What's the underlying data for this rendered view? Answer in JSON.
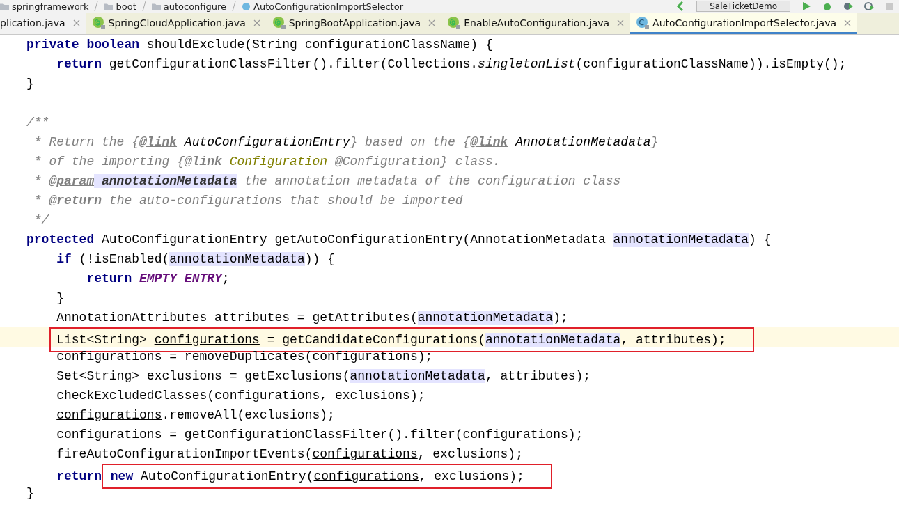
{
  "breadcrumb": [
    {
      "label": "springframework",
      "kind": "folder"
    },
    {
      "label": "boot",
      "kind": "folder"
    },
    {
      "label": "autoconfigure",
      "kind": "folder"
    },
    {
      "label": "AutoConfigurationImportSelector",
      "kind": "class"
    }
  ],
  "run_config": "SaleTicketDemo",
  "tabs": [
    {
      "label": "plication.java",
      "kind": "none",
      "selected": false
    },
    {
      "label": "SpringCloudApplication.java",
      "kind": "annotation",
      "selected": false
    },
    {
      "label": "SpringBootApplication.java",
      "kind": "annotation",
      "selected": false
    },
    {
      "label": "EnableAutoConfiguration.java",
      "kind": "annotation",
      "selected": false
    },
    {
      "label": "AutoConfigurationImportSelector.java",
      "kind": "class",
      "selected": true
    }
  ],
  "lines": [
    {
      "kind": "code",
      "tokens": [
        {
          "text": "private boolean",
          "kind": "kw"
        },
        {
          "text": " shouldExclude(String configurationClassName) {",
          "kind": "plain"
        }
      ],
      "children": [
        {
          "kind": "code",
          "tokens": [
            {
              "text": "return",
              "kind": "kw"
            },
            {
              "text": " getConfigurationClassFilter().filter(Collections.",
              "kind": "plain"
            },
            {
              "text": "singletonList",
              "kind": "static"
            },
            {
              "text": "(configurationClassName)).isEmpty();",
              "kind": "plain"
            }
          ]
        }
      ]
    },
    {
      "kind": "code",
      "tokens": [
        {
          "text": "}",
          "kind": "plain"
        }
      ]
    },
    {
      "kind": "blank"
    },
    {
      "kind": "code",
      "tokens": [
        {
          "text": "/**",
          "kind": "doc"
        }
      ]
    },
    {
      "kind": "code",
      "tokens": [
        {
          "text": " * Return the {",
          "kind": "doc"
        },
        {
          "text": "@link",
          "kind": "doctag"
        },
        {
          "text": " AutoConfigurationEntry",
          "kind": "docref"
        },
        {
          "text": "} based on the {",
          "kind": "doc"
        },
        {
          "text": "@link",
          "kind": "doctag"
        },
        {
          "text": " AnnotationMetadata",
          "kind": "docref"
        },
        {
          "text": "}",
          "kind": "doc"
        }
      ]
    },
    {
      "kind": "code",
      "tokens": [
        {
          "text": " * of the importing {",
          "kind": "doc"
        },
        {
          "text": "@link",
          "kind": "doctag"
        },
        {
          "text": " Configuration",
          "kind": "docclass"
        },
        {
          "text": " @Configuration} class.",
          "kind": "doc"
        }
      ]
    },
    {
      "kind": "code",
      "tokens": [
        {
          "text": " * ",
          "kind": "doc"
        },
        {
          "text": "@param",
          "kind": "doctag"
        },
        {
          "text": " annotationMetadata",
          "kind": "param"
        },
        {
          "text": " the annotation metadata of the configuration class",
          "kind": "doc"
        }
      ]
    },
    {
      "kind": "code",
      "tokens": [
        {
          "text": " * ",
          "kind": "doc"
        },
        {
          "text": "@return",
          "kind": "doctag"
        },
        {
          "text": " the auto-configurations that should be imported",
          "kind": "doc"
        }
      ]
    },
    {
      "kind": "code",
      "tokens": [
        {
          "text": " */",
          "kind": "doc"
        }
      ]
    },
    {
      "kind": "code",
      "tokens": [
        {
          "text": "protected",
          "kind": "kw"
        },
        {
          "text": " AutoConfigurationEntry getAutoConfigurationEntry(AnnotationMetadata ",
          "kind": "plain"
        },
        {
          "text": "annotationMetadata",
          "kind": "hl"
        },
        {
          "text": ") {",
          "kind": "plain"
        }
      ],
      "children": [
        {
          "kind": "code",
          "tokens": [
            {
              "text": "if",
              "kind": "kw"
            },
            {
              "text": " (!isEnabled(",
              "kind": "plain"
            },
            {
              "text": "annotationMetadata",
              "kind": "hl"
            },
            {
              "text": ")) {",
              "kind": "plain"
            }
          ],
          "children": [
            {
              "kind": "code",
              "tokens": [
                {
                  "text": "return",
                  "kind": "kw"
                },
                {
                  "text": " EMPTY_ENTRY",
                  "kind": "const"
                },
                {
                  "text": ";",
                  "kind": "plain"
                }
              ]
            }
          ]
        },
        {
          "kind": "code",
          "tokens": [
            {
              "text": "}",
              "kind": "plain"
            }
          ]
        },
        {
          "kind": "code",
          "tokens": [
            {
              "text": "AnnotationAttributes attributes = getAttributes(",
              "kind": "plain"
            },
            {
              "text": "annotationMetadata",
              "kind": "hl"
            },
            {
              "text": ");",
              "kind": "plain"
            }
          ]
        },
        {
          "kind": "code",
          "current": true,
          "boxed": [
            {
              "text": "List<String> ",
              "kind": "plain"
            },
            {
              "text": "configurations",
              "kind": "var"
            },
            {
              "text": " = getCandidateConfigurations(",
              "kind": "plain"
            },
            {
              "text": "annotationMetadata",
              "kind": "hl"
            },
            {
              "text": ", attributes);",
              "kind": "plain"
            }
          ]
        },
        {
          "kind": "code",
          "tokens": [
            {
              "text": "configurations",
              "kind": "var"
            },
            {
              "text": " = removeDuplicates(",
              "kind": "plain"
            },
            {
              "text": "configurations",
              "kind": "var"
            },
            {
              "text": ");",
              "kind": "plain"
            }
          ]
        },
        {
          "kind": "code",
          "tokens": [
            {
              "text": "Set<String> exclusions = getExclusions(",
              "kind": "plain"
            },
            {
              "text": "annotationMetadata",
              "kind": "hl"
            },
            {
              "text": ", attributes);",
              "kind": "plain"
            }
          ]
        },
        {
          "kind": "code",
          "tokens": [
            {
              "text": "checkExcludedClasses(",
              "kind": "plain"
            },
            {
              "text": "configurations",
              "kind": "var"
            },
            {
              "text": ", exclusions);",
              "kind": "plain"
            }
          ]
        },
        {
          "kind": "code",
          "tokens": [
            {
              "text": "configurations",
              "kind": "var"
            },
            {
              "text": ".removeAll(exclusions);",
              "kind": "plain"
            }
          ]
        },
        {
          "kind": "code",
          "tokens": [
            {
              "text": "configurations",
              "kind": "var"
            },
            {
              "text": " = getConfigurationClassFilter().filter(",
              "kind": "plain"
            },
            {
              "text": "configurations",
              "kind": "var"
            },
            {
              "text": ");",
              "kind": "plain"
            }
          ]
        },
        {
          "kind": "code",
          "tokens": [
            {
              "text": "fireAutoConfigurationImportEvents(",
              "kind": "plain"
            },
            {
              "text": "configurations",
              "kind": "var"
            },
            {
              "text": ", exclusions);",
              "kind": "plain"
            }
          ]
        },
        {
          "kind": "code",
          "tokens": [
            {
              "text": "return",
              "kind": "kw"
            }
          ],
          "boxed": [
            {
              "text": " new",
              "kind": "kw"
            },
            {
              "text": " AutoConfigurationEntry(",
              "kind": "plain"
            },
            {
              "text": "configurations",
              "kind": "var"
            },
            {
              "text": ", exclusions);",
              "kind": "plain"
            }
          ]
        }
      ]
    },
    {
      "kind": "code",
      "tokens": [
        {
          "text": "}",
          "kind": "plain"
        }
      ]
    }
  ]
}
